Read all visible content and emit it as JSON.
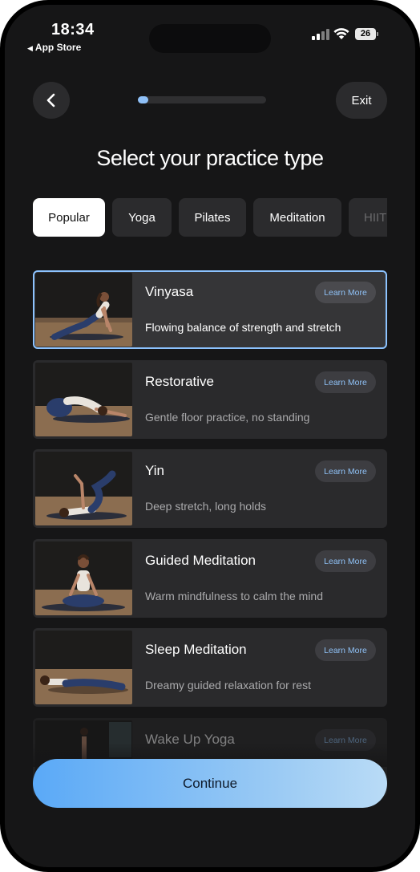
{
  "status_bar": {
    "time": "18:34",
    "back_app": "App Store",
    "battery": "26"
  },
  "header": {
    "exit_label": "Exit",
    "progress_fraction": 0.08
  },
  "page_title": "Select your practice type",
  "tabs": [
    {
      "label": "Popular",
      "active": true
    },
    {
      "label": "Yoga",
      "active": false
    },
    {
      "label": "Pilates",
      "active": false
    },
    {
      "label": "Meditation",
      "active": false
    },
    {
      "label": "HIIT",
      "active": false
    }
  ],
  "practices": [
    {
      "title": "Vinyasa",
      "description": "Flowing balance of strength and stretch",
      "learn_more": "Learn More",
      "selected": true
    },
    {
      "title": "Restorative",
      "description": "Gentle floor practice, no standing",
      "learn_more": "Learn More",
      "selected": false
    },
    {
      "title": "Yin",
      "description": "Deep stretch, long holds",
      "learn_more": "Learn More",
      "selected": false
    },
    {
      "title": "Guided Meditation",
      "description": "Warm mindfulness to calm the mind",
      "learn_more": "Learn More",
      "selected": false
    },
    {
      "title": "Sleep Meditation",
      "description": "Dreamy guided relaxation for rest",
      "learn_more": "Learn More",
      "selected": false
    },
    {
      "title": "Wake Up Yoga",
      "description": "",
      "learn_more": "Learn More",
      "selected": false
    }
  ],
  "continue_label": "Continue",
  "colors": {
    "accent": "#8cc3ff",
    "background": "#161617",
    "card": "#2a2a2c"
  }
}
